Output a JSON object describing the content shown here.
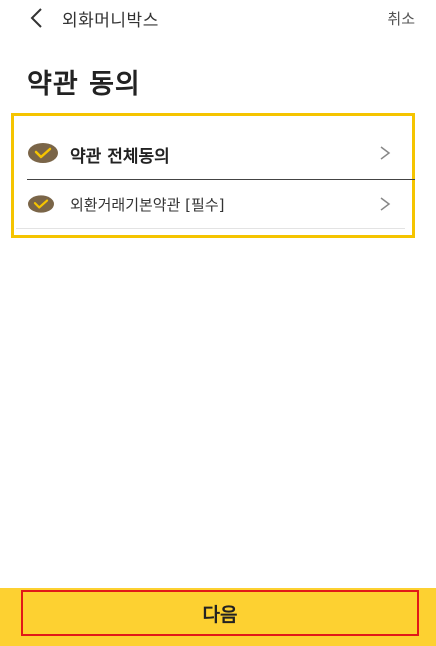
{
  "header": {
    "back_icon": "chevron-left-icon",
    "title": "외화머니박스",
    "cancel_label": "취소"
  },
  "page_title": "약관 동의",
  "agreements": {
    "all": {
      "label": "약관 전체동의",
      "checked": true
    },
    "items": [
      {
        "label": "외환거래기본약관 [필수]",
        "checked": true
      }
    ]
  },
  "footer": {
    "next_label": "다음"
  },
  "colors": {
    "accent_yellow": "#fdd131",
    "check_circle": "#7a6548",
    "check_mark": "#f5c400",
    "highlight_yellow": "#f5c400",
    "highlight_red": "#e11818"
  }
}
